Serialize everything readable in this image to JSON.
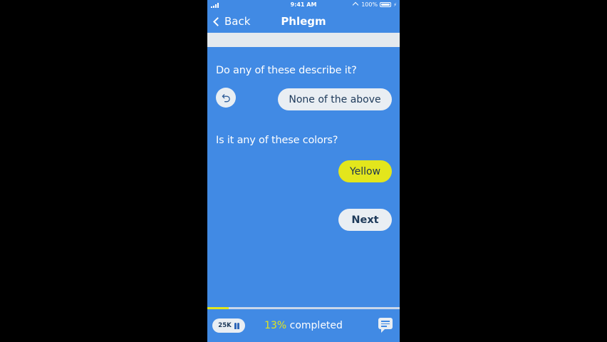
{
  "status_bar": {
    "time": "9:41 AM",
    "battery": "100%",
    "icons": [
      "signal-icon",
      "location-icon",
      "battery-icon",
      "charging-icon"
    ]
  },
  "nav": {
    "back_label": "Back",
    "title": "Phlegm",
    "back_icon": "chevron-left-icon"
  },
  "questions": [
    {
      "text": "Do any of these describe it?",
      "undo_icon": "undo-icon",
      "options": [
        "None of the above"
      ]
    },
    {
      "text": "Is it any of these colors?",
      "options": [
        "Yellow"
      ]
    }
  ],
  "next_label": "Next",
  "footer": {
    "user_count": "25K",
    "people_icon": "people-icon",
    "percent": "13%",
    "completed_label": " completed",
    "progress": 0.13,
    "chat_icon": "chat-icon"
  },
  "colors": {
    "background": "#418AE4",
    "accent_yellow": "#E3E61C",
    "pill": "#E9EEF3",
    "pill_text": "#1E3A5A"
  }
}
